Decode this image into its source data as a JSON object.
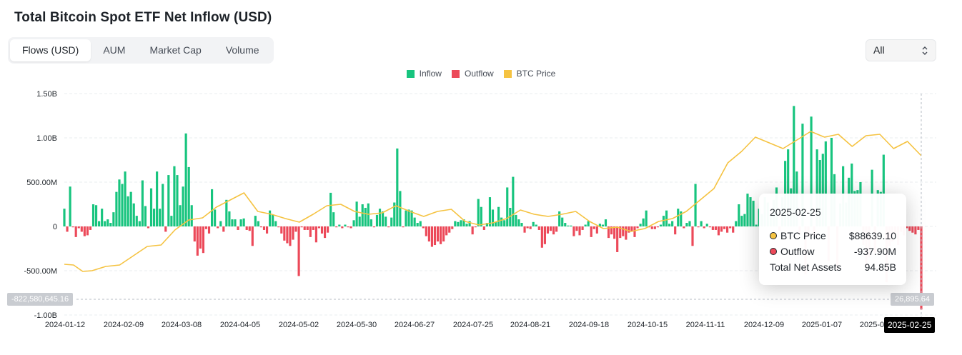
{
  "title": "Total Bitcoin Spot ETF Net Inflow (USD)",
  "tabs": [
    {
      "label": "Flows (USD)",
      "active": true
    },
    {
      "label": "AUM",
      "active": false
    },
    {
      "label": "Market Cap",
      "active": false
    },
    {
      "label": "Volume",
      "active": false
    }
  ],
  "range_select": {
    "value": "All"
  },
  "legend": [
    {
      "label": "Inflow",
      "color": "#17c47e"
    },
    {
      "label": "Outflow",
      "color": "#ec4959"
    },
    {
      "label": "BTC Price",
      "color": "#f5c342"
    }
  ],
  "tooltip": {
    "date": "2025-02-25",
    "rows": [
      {
        "label": "BTC Price",
        "value": "$88639.10",
        "dot": "#f5c342"
      },
      {
        "label": "Outflow",
        "value": "-937.90M",
        "dot": "#ec4959"
      },
      {
        "label": "Total Net Assets",
        "value": "94.85B",
        "dot": null
      }
    ]
  },
  "crosshair": {
    "y_value_label": "-822,580,645.16",
    "right_value_label": "26,895.64",
    "date_label": "2025-02-25"
  },
  "chart_data": {
    "type": "bar",
    "ylim": [
      -1000000000,
      1500000000
    ],
    "yticks": [
      {
        "value": 1500000000,
        "label": "1.50B"
      },
      {
        "value": 1000000000,
        "label": "1.00B"
      },
      {
        "value": 500000000,
        "label": "500.00M"
      },
      {
        "value": 0,
        "label": "0"
      },
      {
        "value": -500000000,
        "label": "-500.00M"
      },
      {
        "value": -1000000000,
        "label": "-1.00B"
      }
    ],
    "xticks": [
      "2024-01-12",
      "2024-02-09",
      "2024-03-08",
      "2024-04-05",
      "2024-05-02",
      "2024-05-30",
      "2024-06-27",
      "2024-07-25",
      "2024-08-21",
      "2024-09-18",
      "2024-10-15",
      "2024-11-11",
      "2024-12-09",
      "2025-01-07",
      "2025-0",
      "2025-02-25"
    ],
    "flow_values_millions": [
      200,
      -60,
      450,
      -10,
      -120,
      -20,
      -60,
      -110,
      -100,
      -40,
      250,
      240,
      60,
      200,
      60,
      80,
      40,
      160,
      390,
      530,
      480,
      620,
      340,
      390,
      260,
      120,
      60,
      520,
      230,
      -20,
      430,
      200,
      620,
      200,
      480,
      -60,
      580,
      120,
      680,
      580,
      240,
      450,
      1050,
      670,
      240,
      -170,
      -330,
      -250,
      -300,
      -30,
      -80,
      420,
      190,
      -20,
      60,
      -60,
      300,
      170,
      80,
      80,
      -40,
      80,
      90,
      -40,
      -50,
      -220,
      120,
      60,
      -10,
      -40,
      -80,
      180,
      130,
      60,
      -10,
      -80,
      -160,
      -190,
      -220,
      -150,
      -60,
      -560,
      -10,
      -40,
      -40,
      -120,
      -40,
      -180,
      -20,
      -80,
      -130,
      -70,
      380,
      160,
      -10,
      20,
      -20,
      20,
      -10,
      -20,
      70,
      280,
      110,
      250,
      210,
      260,
      80,
      -10,
      130,
      200,
      170,
      110,
      -10,
      100,
      270,
      880,
      400,
      -10,
      180,
      190,
      180,
      100,
      40,
      60,
      -20,
      -110,
      -170,
      -230,
      -210,
      -170,
      -200,
      -170,
      -100,
      -70,
      -30,
      60,
      50,
      70,
      80,
      30,
      60,
      -90,
      -10,
      310,
      220,
      -40,
      40,
      330,
      190,
      50,
      220,
      100,
      70,
      440,
      210,
      560,
      130,
      80,
      40,
      -70,
      -20,
      -30,
      50,
      20,
      -40,
      -240,
      -200,
      -80,
      -50,
      -90,
      -60,
      170,
      100,
      40,
      10,
      10,
      -110,
      -50,
      -100,
      -40,
      20,
      60,
      -120,
      -30,
      -80,
      30,
      20,
      80,
      -130,
      -90,
      -140,
      -290,
      -130,
      -110,
      -150,
      -70,
      -60,
      -120,
      -20,
      30,
      90,
      180,
      -10,
      -30,
      -30,
      -10,
      20,
      120,
      180,
      30,
      60,
      -90,
      200,
      170,
      -20,
      40,
      60,
      -220,
      480,
      -10,
      60,
      -20,
      30,
      -10,
      -40,
      -40,
      -100,
      -60,
      -30,
      -70,
      -20,
      -70,
      60,
      250,
      120,
      140,
      370,
      330,
      290,
      20,
      200,
      140,
      330,
      270,
      130,
      300,
      440,
      -50,
      330,
      740,
      870,
      430,
      1360,
      620,
      -80,
      1160,
      -540,
      -120,
      1240,
      -110,
      870,
      750,
      820,
      960,
      -390,
      1000,
      590,
      -480,
      260,
      680,
      270,
      550,
      710,
      400,
      410,
      500,
      -210,
      -450,
      -350,
      640,
      -300,
      410,
      390,
      810,
      -630,
      -220,
      -170,
      -100,
      -210,
      -60,
      -100,
      -20,
      -50,
      -70,
      -90,
      -40,
      -938
    ]
  }
}
